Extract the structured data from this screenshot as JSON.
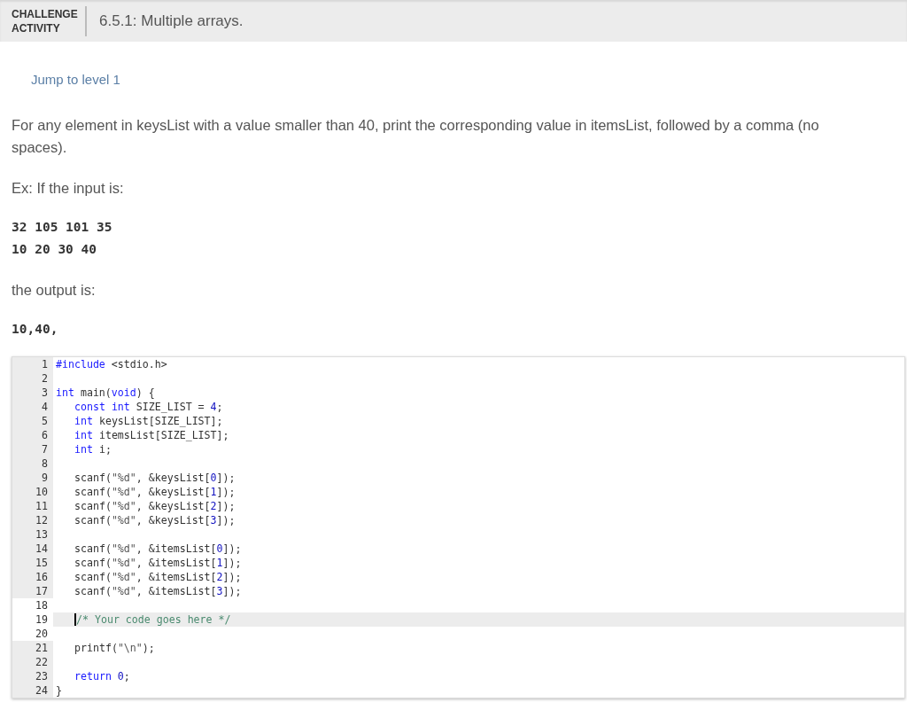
{
  "header": {
    "badge": "CHALLENGE ACTIVITY",
    "title": "6.5.1: Multiple arrays."
  },
  "jump_link": "Jump to level 1",
  "prompt": "For any element in keysList with a value smaller than 40, print the corresponding value in itemsList, followed by a comma (no spaces).",
  "example_label": "Ex: If the input is:",
  "example_input": [
    "32 105 101 35",
    "10 20 30 40"
  ],
  "output_label": "the output is:",
  "example_output": [
    "10,40,"
  ],
  "editor": {
    "lines": [
      {
        "number": "1",
        "editable": false,
        "current": false,
        "indent": false,
        "tokens": [
          {
            "kind": "pre",
            "text": "#include"
          },
          {
            "kind": "plain",
            "text": " <stdio.h>"
          }
        ]
      },
      {
        "number": "2",
        "editable": false,
        "current": false
      },
      {
        "number": "3",
        "editable": false,
        "current": false,
        "indent": false,
        "tokens": [
          {
            "kind": "kw",
            "text": "int"
          },
          {
            "kind": "plain",
            "text": " main("
          },
          {
            "kind": "kw",
            "text": "void"
          },
          {
            "kind": "plain",
            "text": ") {"
          }
        ]
      },
      {
        "number": "4",
        "editable": false,
        "current": false,
        "indent": true,
        "tokens": [
          {
            "kind": "kw",
            "text": "const"
          },
          {
            "kind": "kw",
            "text": " int"
          },
          {
            "kind": "plain",
            "text": " SIZE_LIST = "
          },
          {
            "kind": "num",
            "text": "4"
          },
          {
            "kind": "plain",
            "text": ";"
          }
        ]
      },
      {
        "number": "5",
        "editable": false,
        "current": false,
        "indent": true,
        "tokens": [
          {
            "kind": "kw",
            "text": "int"
          },
          {
            "kind": "plain",
            "text": " keysList[SIZE_LIST];"
          }
        ]
      },
      {
        "number": "6",
        "editable": false,
        "current": false,
        "indent": true,
        "tokens": [
          {
            "kind": "kw",
            "text": "int"
          },
          {
            "kind": "plain",
            "text": " itemsList[SIZE_LIST];"
          }
        ]
      },
      {
        "number": "7",
        "editable": false,
        "current": false,
        "indent": true,
        "tokens": [
          {
            "kind": "kw",
            "text": "int"
          },
          {
            "kind": "plain",
            "text": " i;"
          }
        ]
      },
      {
        "number": "8",
        "editable": false,
        "current": false
      },
      {
        "number": "9",
        "editable": false,
        "current": false,
        "indent": true,
        "tokens": [
          {
            "kind": "plain",
            "text": "scanf("
          },
          {
            "kind": "str",
            "text": "\"%d\""
          },
          {
            "kind": "plain",
            "text": ", &keysList["
          },
          {
            "kind": "num",
            "text": "0"
          },
          {
            "kind": "plain",
            "text": "]);"
          }
        ]
      },
      {
        "number": "10",
        "editable": false,
        "current": false,
        "indent": true,
        "tokens": [
          {
            "kind": "plain",
            "text": "scanf("
          },
          {
            "kind": "str",
            "text": "\"%d\""
          },
          {
            "kind": "plain",
            "text": ", &keysList["
          },
          {
            "kind": "num",
            "text": "1"
          },
          {
            "kind": "plain",
            "text": "]);"
          }
        ]
      },
      {
        "number": "11",
        "editable": false,
        "current": false,
        "indent": true,
        "tokens": [
          {
            "kind": "plain",
            "text": "scanf("
          },
          {
            "kind": "str",
            "text": "\"%d\""
          },
          {
            "kind": "plain",
            "text": ", &keysList["
          },
          {
            "kind": "num",
            "text": "2"
          },
          {
            "kind": "plain",
            "text": "]);"
          }
        ]
      },
      {
        "number": "12",
        "editable": false,
        "current": false,
        "indent": true,
        "tokens": [
          {
            "kind": "plain",
            "text": "scanf("
          },
          {
            "kind": "str",
            "text": "\"%d\""
          },
          {
            "kind": "plain",
            "text": ", &keysList["
          },
          {
            "kind": "num",
            "text": "3"
          },
          {
            "kind": "plain",
            "text": "]);"
          }
        ]
      },
      {
        "number": "13",
        "editable": false,
        "current": false
      },
      {
        "number": "14",
        "editable": false,
        "current": false,
        "indent": true,
        "tokens": [
          {
            "kind": "plain",
            "text": "scanf("
          },
          {
            "kind": "str",
            "text": "\"%d\""
          },
          {
            "kind": "plain",
            "text": ", &itemsList["
          },
          {
            "kind": "num",
            "text": "0"
          },
          {
            "kind": "plain",
            "text": "]);"
          }
        ]
      },
      {
        "number": "15",
        "editable": false,
        "current": false,
        "indent": true,
        "tokens": [
          {
            "kind": "plain",
            "text": "scanf("
          },
          {
            "kind": "str",
            "text": "\"%d\""
          },
          {
            "kind": "plain",
            "text": ", &itemsList["
          },
          {
            "kind": "num",
            "text": "1"
          },
          {
            "kind": "plain",
            "text": "]);"
          }
        ]
      },
      {
        "number": "16",
        "editable": false,
        "current": false,
        "indent": true,
        "tokens": [
          {
            "kind": "plain",
            "text": "scanf("
          },
          {
            "kind": "str",
            "text": "\"%d\""
          },
          {
            "kind": "plain",
            "text": ", &itemsList["
          },
          {
            "kind": "num",
            "text": "2"
          },
          {
            "kind": "plain",
            "text": "]);"
          }
        ]
      },
      {
        "number": "17",
        "editable": false,
        "current": false,
        "indent": true,
        "tokens": [
          {
            "kind": "plain",
            "text": "scanf("
          },
          {
            "kind": "str",
            "text": "\"%d\""
          },
          {
            "kind": "plain",
            "text": ", &itemsList["
          },
          {
            "kind": "num",
            "text": "3"
          },
          {
            "kind": "plain",
            "text": "]);"
          }
        ]
      },
      {
        "number": "18",
        "editable": true,
        "current": false
      },
      {
        "number": "19",
        "editable": true,
        "current": true,
        "indent": true,
        "tokens": [
          {
            "kind": "com",
            "text": "/* Your code goes here */"
          }
        ]
      },
      {
        "number": "20",
        "editable": true,
        "current": false
      },
      {
        "number": "21",
        "editable": false,
        "current": false,
        "indent": true,
        "tokens": [
          {
            "kind": "plain",
            "text": "printf("
          },
          {
            "kind": "str",
            "text": "\"\\n\""
          },
          {
            "kind": "plain",
            "text": ");"
          }
        ]
      },
      {
        "number": "22",
        "editable": false,
        "current": false
      },
      {
        "number": "23",
        "editable": false,
        "current": false,
        "indent": true,
        "tokens": [
          {
            "kind": "kw",
            "text": "return"
          },
          {
            "kind": "num",
            "text": " 0"
          },
          {
            "kind": "plain",
            "text": ";"
          }
        ]
      },
      {
        "number": "24",
        "editable": false,
        "current": false,
        "indent": false,
        "tokens": [
          {
            "kind": "plain",
            "text": "}"
          }
        ]
      }
    ]
  }
}
